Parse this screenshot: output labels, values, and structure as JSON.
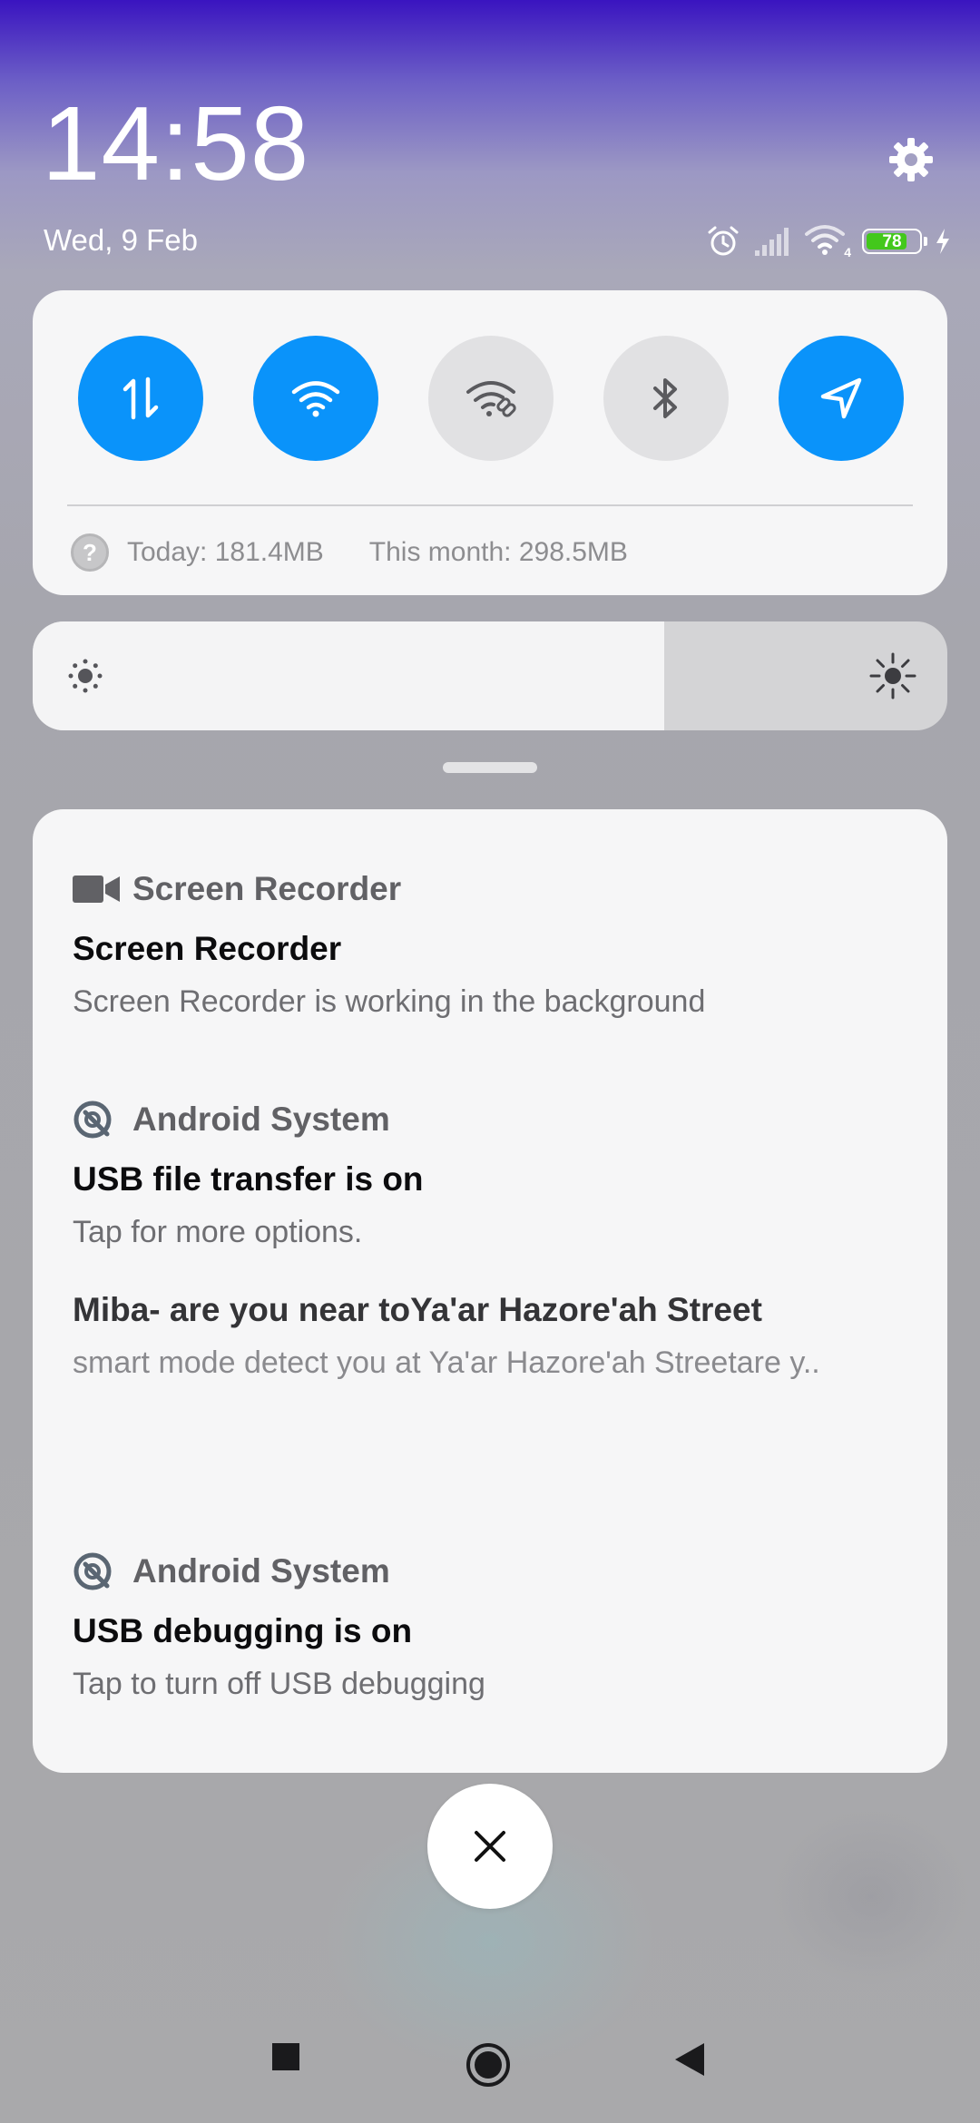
{
  "header": {
    "time": "14:58",
    "date": "Wed, 9 Feb",
    "battery_level": "78",
    "battery_fraction": 0.78,
    "wifi_badge": "4"
  },
  "quick_settings": {
    "toggles": [
      {
        "name": "mobile-data",
        "icon": "data-arrows-icon",
        "state": "on"
      },
      {
        "name": "wifi",
        "icon": "wifi-icon",
        "state": "on"
      },
      {
        "name": "hotspot",
        "icon": "hotspot-icon",
        "state": "off"
      },
      {
        "name": "bluetooth",
        "icon": "bluetooth-icon",
        "state": "off"
      },
      {
        "name": "location",
        "icon": "location-arrow-icon",
        "state": "on"
      }
    ],
    "data_usage": {
      "today": "Today: 181.4MB",
      "month": "This month: 298.5MB"
    }
  },
  "brightness": {
    "level_fraction": 0.69
  },
  "notifications": [
    {
      "app": "Screen Recorder",
      "icon": "video-camera-icon",
      "title": "Screen Recorder",
      "text": "Screen Recorder is working in the background"
    },
    {
      "app": "Android System",
      "icon": "android-system-icon",
      "title": "USB file transfer is on",
      "text": "Tap for more options.",
      "extra_title": "Miba- are you near toYa'ar Hazore'ah Street",
      "extra_text": "smart mode detect you at Ya'ar Hazore'ah Streetare y.."
    },
    {
      "app": "Android System",
      "icon": "android-system-icon",
      "title": "USB debugging is on",
      "text": "Tap to turn off USB debugging"
    }
  ],
  "colors": {
    "accent": "#0a93fa",
    "toggle_off": "#e1e1e3",
    "battery_green": "#43c81c"
  },
  "nav": {
    "buttons": [
      "recents-square-icon",
      "home-circle-icon",
      "back-triangle-icon"
    ]
  }
}
